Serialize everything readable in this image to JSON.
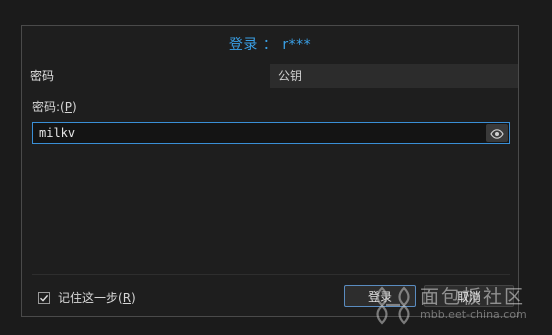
{
  "dialog": {
    "title": "登录 ： r***"
  },
  "tabs": [
    {
      "label": "密码",
      "active": true
    },
    {
      "label": "公钥",
      "active": false
    }
  ],
  "password": {
    "label_prefix": "密码:(",
    "label_mnemonic": "P",
    "label_suffix": ")",
    "value": "milkv",
    "toggle_icon": "eye-icon"
  },
  "remember": {
    "checked": true,
    "label_prefix": "记住这一步(",
    "label_mnemonic": "R",
    "label_suffix": ")"
  },
  "buttons": {
    "login": "登录",
    "cancel": "取消"
  },
  "watermark": {
    "title": "面包板社区",
    "url": "mbb.eet-china.com"
  },
  "colors": {
    "accent": "#3aa0e6",
    "background": "#1b1b1b",
    "input_border": "#3a8fd6"
  }
}
